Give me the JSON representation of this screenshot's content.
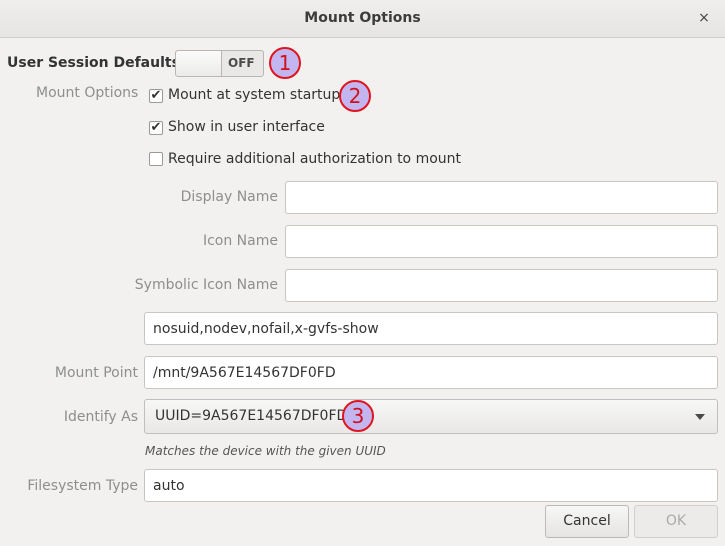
{
  "window": {
    "title": "Mount Options",
    "close_glyph": "×"
  },
  "user_session_defaults": {
    "label": "User Session Defaults",
    "switch_state": "OFF"
  },
  "mount_options": {
    "label": "Mount Options",
    "checkboxes": [
      {
        "label": "Mount at system startup",
        "checked": true
      },
      {
        "label": "Show in user interface",
        "checked": true
      },
      {
        "label": "Require additional authorization to mount",
        "checked": false
      }
    ]
  },
  "fields": {
    "display_name": {
      "label": "Display Name",
      "value": ""
    },
    "icon_name": {
      "label": "Icon Name",
      "value": ""
    },
    "symbolic_icon_name": {
      "label": "Symbolic Icon Name",
      "value": ""
    },
    "options": {
      "value": "nosuid,nodev,nofail,x-gvfs-show"
    },
    "mount_point": {
      "label": "Mount Point",
      "value": "/mnt/9A567E14567DF0FD"
    },
    "identify_as": {
      "label": "Identify As",
      "selected": "UUID=9A567E14567DF0FD",
      "hint": "Matches the device with the given UUID"
    },
    "filesystem_type": {
      "label": "Filesystem Type",
      "value": "auto"
    }
  },
  "buttons": {
    "cancel": "Cancel",
    "ok": "OK"
  },
  "annotations": [
    "1",
    "2",
    "3"
  ],
  "colors": {
    "badge_fill": "#c3b6f0",
    "badge_stroke": "#e0141e"
  },
  "icons": {
    "check": "check-icon",
    "dropdown": "chevron-down-icon"
  }
}
